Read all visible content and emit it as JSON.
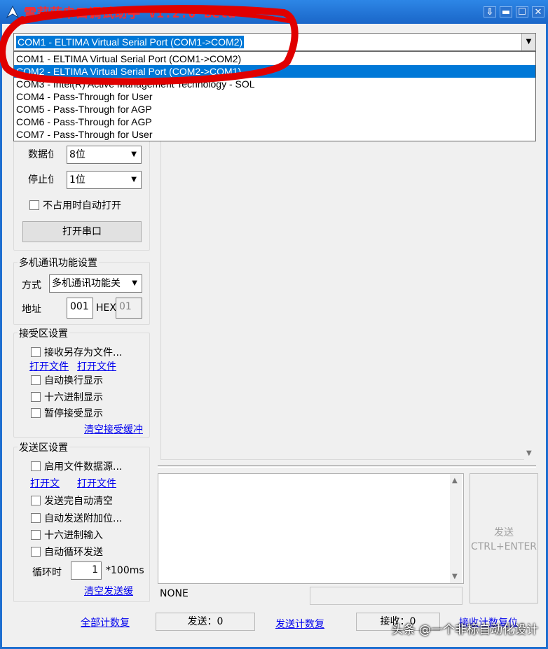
{
  "window": {
    "title": "雪莉蓝串口调试助手 V1.2.0 Beta",
    "controls": [
      "⇩",
      "▬",
      "☐",
      "✕"
    ]
  },
  "port_combo": {
    "value": "COM1 - ELTIMA Virtual Serial Port (COM1->COM2)",
    "options": [
      "COM1 - ELTIMA Virtual Serial Port (COM1->COM2)",
      "COM2 - ELTIMA Virtual Serial Port (COM2->COM1)",
      "COM3 - Intel(R) Active Management Technology - SOL",
      "COM4 - Pass-Through for User",
      "COM5 - Pass-Through for AGP",
      "COM6 - Pass-Through for AGP",
      "COM7 - Pass-Through for User"
    ],
    "highlighted_index": 1
  },
  "serial": {
    "databits_label": "数据位",
    "databits_value": "8位",
    "stopbits_label": "停止位",
    "stopbits_value": "1位",
    "auto_open_label": "不占用时自动打开",
    "open_button": "打开串口"
  },
  "multi": {
    "title": "多机通讯功能设置",
    "mode_label": "方式",
    "mode_value": "多机通讯功能关",
    "addr_label": "地址",
    "addr_value": "001",
    "hex_label": "HEX",
    "hex_value": "01"
  },
  "receive": {
    "title": "接受区设置",
    "save_as": "接收另存为文件...",
    "open_file_1": "打开文件",
    "open_file_2": "打开文件",
    "auto_newline": "自动换行显示",
    "hex_display": "十六进制显示",
    "pause_display": "暂停接受显示",
    "clear_buffer": "清空接受缓冲"
  },
  "send": {
    "title": "发送区设置",
    "use_file": "启用文件数据源...",
    "open_file_1": "打开文",
    "open_file_2": "打开文件",
    "auto_clear": "发送完自动清空",
    "auto_append": "自动发送附加位...",
    "hex_input": "十六进制输入",
    "auto_loop": "自动循环发送",
    "loop_label": "循环时",
    "loop_value": "1",
    "loop_unit": "*100ms",
    "clear_buffer": "清空发送缓"
  },
  "send_area": {
    "send_button_line1": "发送",
    "send_button_line2": "CTRL+ENTER",
    "status": "NONE"
  },
  "bottom": {
    "reset_all": "全部计数复",
    "sent_count": "发送：0",
    "reset_sent": "发送计数复",
    "recv_count": "接收：0",
    "reset_recv": "接收计数复位"
  },
  "watermark": "头条 @一个非标自动化设计",
  "colors": {
    "title_text": "#ff2b2b",
    "selection": "#0078d7",
    "annotation": "#e00000",
    "link": "#0000ee"
  }
}
